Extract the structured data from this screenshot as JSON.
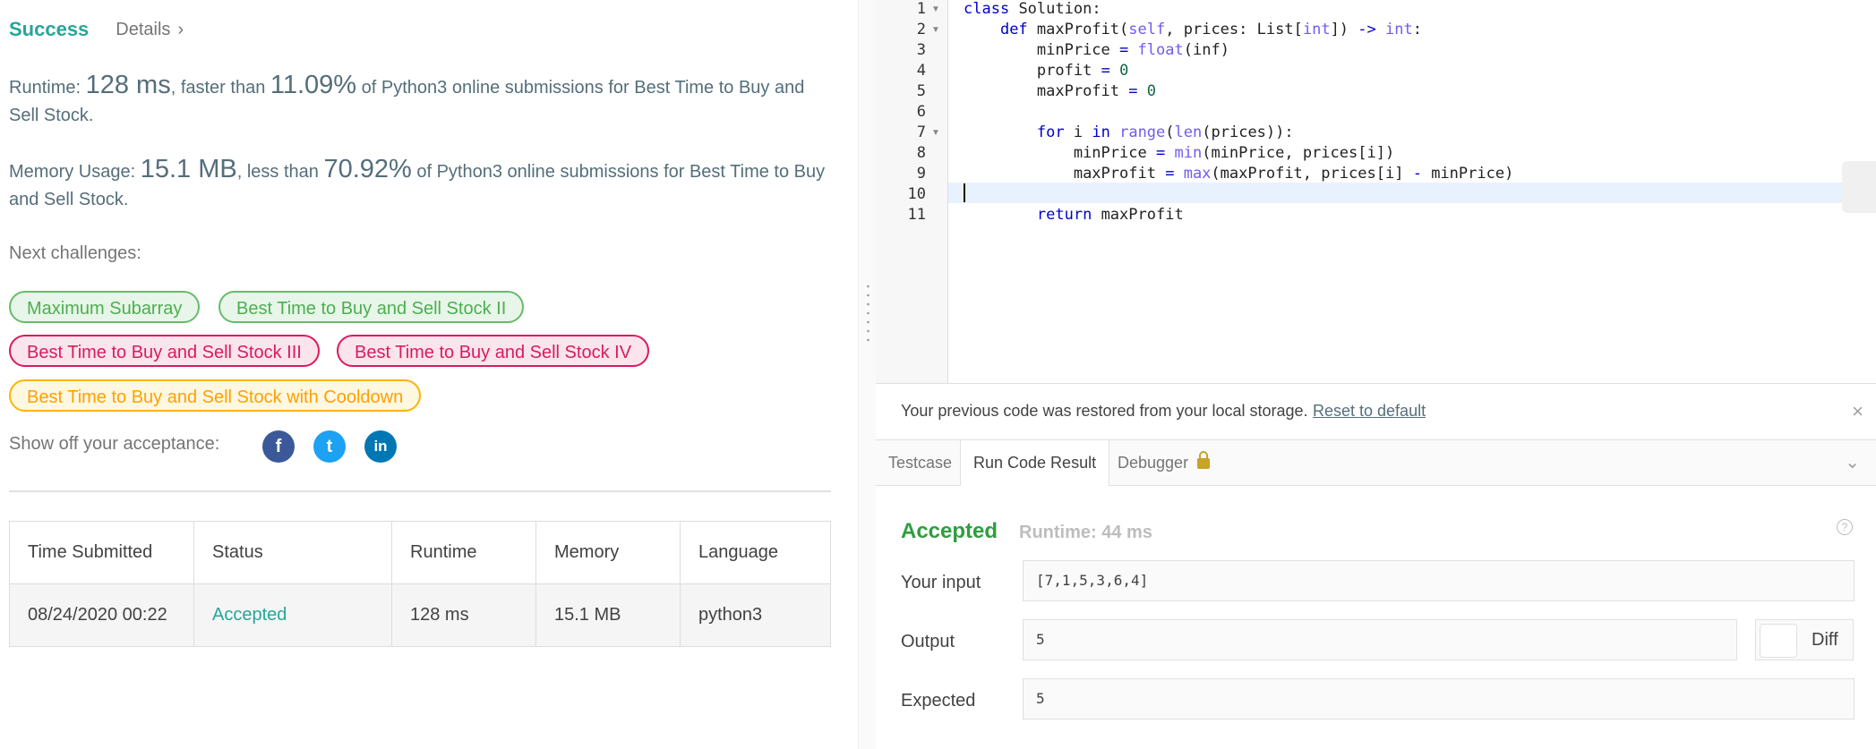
{
  "result_header": {
    "status": "Success",
    "details_label": "Details",
    "details_chevron": "›"
  },
  "runtime_stat": {
    "label": "Runtime: ",
    "value": "128 ms",
    "mid": ", faster than ",
    "percent": "11.09%",
    "suffix": " of Python3 online submissions for Best Time to Buy and Sell Stock."
  },
  "memory_stat": {
    "label": "Memory Usage: ",
    "value": "15.1 MB",
    "mid": ", less than ",
    "percent": "70.92%",
    "suffix": " of Python3 online submissions for Best Time to Buy and Sell Stock."
  },
  "next_challenges": {
    "label": "Next challenges:",
    "items": [
      {
        "label": "Maximum Subarray",
        "difficulty": "easy"
      },
      {
        "label": "Best Time to Buy and Sell Stock II",
        "difficulty": "easy"
      },
      {
        "label": "Best Time to Buy and Sell Stock III",
        "difficulty": "hard"
      },
      {
        "label": "Best Time to Buy and Sell Stock IV",
        "difficulty": "hard"
      },
      {
        "label": "Best Time to Buy and Sell Stock with Cooldown",
        "difficulty": "medium"
      }
    ]
  },
  "share": {
    "label": "Show off your acceptance:",
    "icons": [
      {
        "name": "facebook-icon",
        "glyph": "f",
        "color": "#3b5998"
      },
      {
        "name": "twitter-icon",
        "glyph": "t",
        "color": "#1da1f2"
      },
      {
        "name": "linkedin-icon",
        "glyph": "in",
        "color": "#0077b5"
      }
    ]
  },
  "submissions": {
    "headers": [
      "Time Submitted",
      "Status",
      "Runtime",
      "Memory",
      "Language"
    ],
    "rows": [
      [
        "08/24/2020 00:22",
        "Accepted",
        "128 ms",
        "15.1 MB",
        "python3"
      ]
    ]
  },
  "editor": {
    "line_numbers": [
      "1",
      "2",
      "3",
      "4",
      "5",
      "6",
      "7",
      "8",
      "9",
      "10",
      "11"
    ],
    "lines": [
      "class Solution:",
      "    def maxProfit(self, prices: List[int]) -> int:",
      "        minPrice = float(inf)",
      "        profit = 0",
      "        maxProfit = 0",
      "",
      "        for i in range(len(prices)):",
      "            minPrice = min(minPrice, prices[i])",
      "            maxProfit = max(maxProfit, prices[i] - minPrice)",
      "",
      "        return maxProfit"
    ]
  },
  "notice": {
    "message": "Your previous code was restored from your local storage.",
    "reset_label": "Reset to default",
    "close": "×"
  },
  "tabs": [
    {
      "label": "Testcase"
    },
    {
      "label": "Run Code Result"
    },
    {
      "label": "Debugger"
    }
  ],
  "run_result": {
    "status": "Accepted",
    "runtime": "Runtime: 44 ms",
    "help": "?",
    "input_label": "Your input",
    "input_value": "[7,1,5,3,6,4]",
    "output_label": "Output",
    "output_value": "5",
    "diff_label": "Diff",
    "expected_label": "Expected",
    "expected_value": "5"
  },
  "colors": {
    "accent": "#26a69a",
    "accepted": "#2e9e3f"
  }
}
